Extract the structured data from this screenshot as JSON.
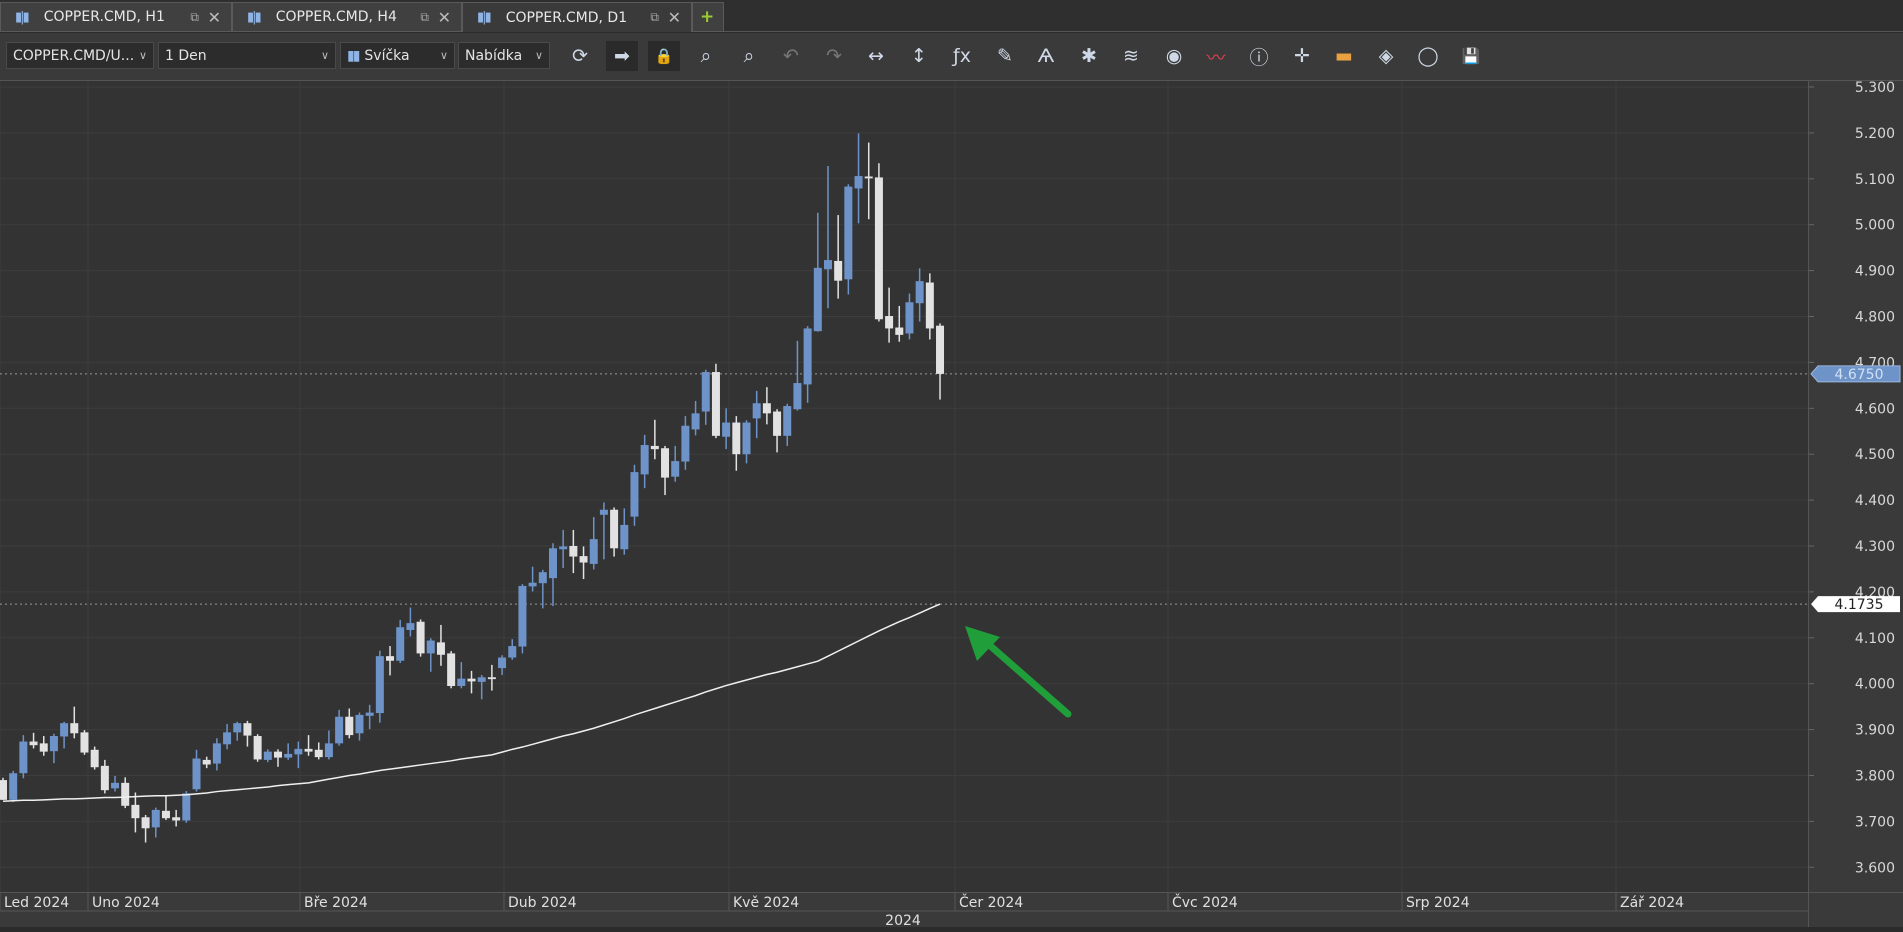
{
  "tabs": [
    {
      "label": "COPPER.CMD, H1",
      "icon": "candles-icon",
      "active": false
    },
    {
      "label": "COPPER.CMD, H4",
      "icon": "candles-icon",
      "active": false
    },
    {
      "label": "COPPER.CMD, D1",
      "icon": "candles-icon",
      "active": true
    }
  ],
  "toolbar": {
    "instrument": "COPPER.CMD/U...",
    "period": "1 Den",
    "chart_type": "Svíčka",
    "price_side": "Nabídka",
    "icons": [
      "refresh-icon",
      "shift-chart-icon",
      "lock-icon",
      "zoom-in-icon",
      "zoom-out-icon",
      "undo-icon",
      "redo-icon",
      "horizontal-resize-icon",
      "vertical-resize-icon",
      "indicators-fx-icon",
      "pencil-icon",
      "compass-icon",
      "network-icon",
      "layers-icon",
      "eye-icon",
      "alert-icon",
      "info-icon",
      "crosshair-icon",
      "color-bar-icon",
      "paint-bucket-icon",
      "refresh-circle-icon",
      "save-icon"
    ]
  },
  "colors": {
    "up": "#6e93c8",
    "down": "#e2e2e2",
    "background": "#333333",
    "arrow": "#1f9e3a",
    "ma": "#f0f0f0"
  },
  "chart_data": {
    "type": "candlestick",
    "symbol": "COPPER.CMD",
    "timeframe": "D1",
    "ylim": [
      3.55,
      5.33
    ],
    "yticks": [
      "5.300",
      "5.200",
      "5.100",
      "5.000",
      "4.900",
      "4.800",
      "4.700",
      "4.600",
      "4.500",
      "4.400",
      "4.300",
      "4.200",
      "4.100",
      "4.000",
      "3.900",
      "3.800",
      "3.700",
      "3.600"
    ],
    "xticks": [
      "Led 2024",
      "Uno 2024",
      "Bře 2024",
      "Dub 2024",
      "Kvě 2024",
      "Čer 2024",
      "Čvc 2024",
      "Srp 2024",
      "Zář 2024"
    ],
    "year_label": "2024",
    "grid": true,
    "last_price": "4.6750",
    "ma_last": "4.1735",
    "ohlc": [
      [
        3.79,
        3.795,
        3.747,
        3.747
      ],
      [
        3.747,
        3.81,
        3.742,
        3.805
      ],
      [
        3.805,
        3.888,
        3.794,
        3.874
      ],
      [
        3.874,
        3.893,
        3.859,
        3.866
      ],
      [
        3.87,
        3.886,
        3.843,
        3.852
      ],
      [
        3.853,
        3.891,
        3.827,
        3.886
      ],
      [
        3.885,
        3.917,
        3.859,
        3.914
      ],
      [
        3.914,
        3.95,
        3.881,
        3.892
      ],
      [
        3.894,
        3.899,
        3.845,
        3.85
      ],
      [
        3.856,
        3.863,
        3.813,
        3.818
      ],
      [
        3.821,
        3.834,
        3.761,
        3.768
      ],
      [
        3.772,
        3.799,
        3.765,
        3.784
      ],
      [
        3.784,
        3.796,
        3.729,
        3.734
      ],
      [
        3.736,
        3.763,
        3.676,
        3.707
      ],
      [
        3.709,
        3.714,
        3.654,
        3.685
      ],
      [
        3.687,
        3.73,
        3.665,
        3.725
      ],
      [
        3.723,
        3.755,
        3.703,
        3.707
      ],
      [
        3.709,
        3.725,
        3.689,
        3.702
      ],
      [
        3.702,
        3.766,
        3.697,
        3.761
      ],
      [
        3.77,
        3.856,
        3.765,
        3.837
      ],
      [
        3.834,
        3.841,
        3.816,
        3.824
      ],
      [
        3.826,
        3.881,
        3.811,
        3.87
      ],
      [
        3.868,
        3.912,
        3.857,
        3.894
      ],
      [
        3.894,
        3.917,
        3.876,
        3.914
      ],
      [
        3.914,
        3.919,
        3.863,
        3.887
      ],
      [
        3.886,
        3.89,
        3.83,
        3.835
      ],
      [
        3.834,
        3.857,
        3.829,
        3.852
      ],
      [
        3.852,
        3.857,
        3.819,
        3.839
      ],
      [
        3.839,
        3.87,
        3.834,
        3.847
      ],
      [
        3.846,
        3.874,
        3.816,
        3.858
      ],
      [
        3.858,
        3.888,
        3.843,
        3.852
      ],
      [
        3.856,
        3.872,
        3.835,
        3.84
      ],
      [
        3.84,
        3.898,
        3.835,
        3.87
      ],
      [
        3.87,
        3.943,
        3.865,
        3.928
      ],
      [
        3.928,
        3.946,
        3.881,
        3.888
      ],
      [
        3.892,
        3.937,
        3.876,
        3.932
      ],
      [
        3.93,
        3.954,
        3.901,
        3.937
      ],
      [
        3.936,
        4.072,
        3.915,
        4.06
      ],
      [
        4.06,
        4.082,
        4.018,
        4.05
      ],
      [
        4.05,
        4.139,
        4.045,
        4.123
      ],
      [
        4.117,
        4.166,
        4.103,
        4.132
      ],
      [
        4.135,
        4.14,
        4.059,
        4.066
      ],
      [
        4.066,
        4.099,
        4.026,
        4.094
      ],
      [
        4.09,
        4.128,
        4.039,
        4.063
      ],
      [
        4.066,
        4.071,
        3.99,
        3.995
      ],
      [
        3.995,
        4.047,
        3.99,
        4.011
      ],
      [
        4.011,
        4.028,
        3.979,
        4.005
      ],
      [
        4.004,
        4.019,
        3.966,
        4.014
      ],
      [
        4.014,
        4.041,
        3.985,
        4.01
      ],
      [
        4.034,
        4.062,
        4.019,
        4.057
      ],
      [
        4.057,
        4.097,
        4.052,
        4.082
      ],
      [
        4.081,
        4.217,
        4.066,
        4.213
      ],
      [
        4.212,
        4.255,
        4.201,
        4.22
      ],
      [
        4.219,
        4.248,
        4.164,
        4.243
      ],
      [
        4.23,
        4.306,
        4.169,
        4.295
      ],
      [
        4.293,
        4.335,
        4.252,
        4.299
      ],
      [
        4.3,
        4.335,
        4.241,
        4.277
      ],
      [
        4.278,
        4.299,
        4.228,
        4.264
      ],
      [
        4.261,
        4.363,
        4.249,
        4.315
      ],
      [
        4.368,
        4.395,
        4.271,
        4.379
      ],
      [
        4.379,
        4.384,
        4.277,
        4.295
      ],
      [
        4.293,
        4.382,
        4.281,
        4.346
      ],
      [
        4.364,
        4.477,
        4.344,
        4.461
      ],
      [
        4.456,
        4.542,
        4.426,
        4.52
      ],
      [
        4.518,
        4.575,
        4.489,
        4.511
      ],
      [
        4.513,
        4.518,
        4.411,
        4.449
      ],
      [
        4.451,
        4.518,
        4.44,
        4.485
      ],
      [
        4.484,
        4.583,
        4.466,
        4.562
      ],
      [
        4.554,
        4.616,
        4.541,
        4.589
      ],
      [
        4.593,
        4.684,
        4.564,
        4.679
      ],
      [
        4.679,
        4.697,
        4.535,
        4.54
      ],
      [
        4.538,
        4.6,
        4.511,
        4.569
      ],
      [
        4.569,
        4.583,
        4.464,
        4.5
      ],
      [
        4.5,
        4.574,
        4.48,
        4.569
      ],
      [
        4.578,
        4.638,
        4.535,
        4.611
      ],
      [
        4.611,
        4.646,
        4.565,
        4.589
      ],
      [
        4.593,
        4.598,
        4.504,
        4.54
      ],
      [
        4.54,
        4.61,
        4.518,
        4.605
      ],
      [
        4.598,
        4.747,
        4.595,
        4.655
      ],
      [
        4.652,
        4.779,
        4.612,
        4.774
      ],
      [
        4.768,
        5.026,
        4.767,
        4.906
      ],
      [
        4.903,
        5.128,
        4.818,
        4.923
      ],
      [
        4.921,
        5.021,
        4.839,
        4.878
      ],
      [
        4.881,
        5.088,
        4.848,
        5.083
      ],
      [
        5.079,
        5.199,
        5.003,
        5.106
      ],
      [
        5.105,
        5.179,
        5.012,
        5.101
      ],
      [
        5.103,
        5.134,
        4.789,
        4.794
      ],
      [
        4.801,
        4.863,
        4.743,
        4.774
      ],
      [
        4.776,
        4.823,
        4.745,
        4.76
      ],
      [
        4.763,
        4.85,
        4.75,
        4.831
      ],
      [
        4.829,
        4.905,
        4.789,
        4.877
      ],
      [
        4.874,
        4.894,
        4.75,
        4.774
      ],
      [
        4.78,
        4.785,
        4.619,
        4.675
      ]
    ],
    "ma": [
      3.744,
      3.745,
      3.746,
      3.746,
      3.747,
      3.748,
      3.749,
      3.749,
      3.75,
      3.751,
      3.752,
      3.752,
      3.753,
      3.754,
      3.755,
      3.756,
      3.756,
      3.757,
      3.758,
      3.76,
      3.762,
      3.765,
      3.767,
      3.769,
      3.771,
      3.773,
      3.775,
      3.778,
      3.78,
      3.782,
      3.784,
      3.788,
      3.792,
      3.796,
      3.8,
      3.803,
      3.807,
      3.811,
      3.814,
      3.817,
      3.82,
      3.823,
      3.826,
      3.829,
      3.832,
      3.836,
      3.839,
      3.842,
      3.845,
      3.851,
      3.857,
      3.862,
      3.868,
      3.874,
      3.88,
      3.886,
      3.891,
      3.897,
      3.903,
      3.91,
      3.917,
      3.924,
      3.932,
      3.939,
      3.946,
      3.953,
      3.96,
      3.967,
      3.974,
      3.982,
      3.989,
      3.996,
      4.002,
      4.008,
      4.014,
      4.02,
      4.025,
      4.031,
      4.037,
      4.043,
      4.049,
      4.06,
      4.071,
      4.082,
      4.093,
      4.104,
      4.115,
      4.125,
      4.135,
      4.144,
      4.154,
      4.164,
      4.1735
    ]
  }
}
